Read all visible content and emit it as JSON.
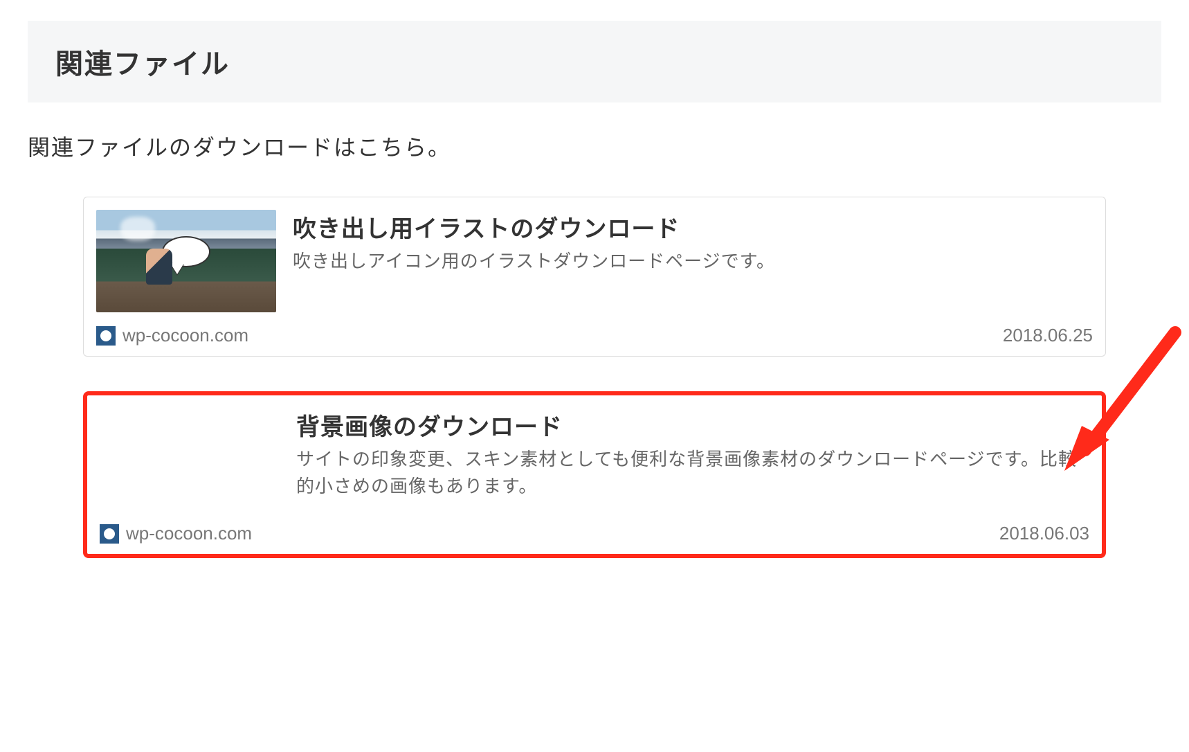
{
  "section": {
    "title": "関連ファイル",
    "intro": "関連ファイルのダウンロードはこちら。"
  },
  "cards": [
    {
      "title": "吹き出し用イラストのダウンロード",
      "description": "吹き出しアイコン用のイラストダウンロードページです。",
      "site": "wp-cocoon.com",
      "date": "2018.06.25",
      "highlighted": false
    },
    {
      "title": "背景画像のダウンロード",
      "description": "サイトの印象変更、スキン素材としても便利な背景画像素材のダウンロードページです。比較的小さめの画像もあります。",
      "site": "wp-cocoon.com",
      "date": "2018.06.03",
      "highlighted": true
    }
  ]
}
